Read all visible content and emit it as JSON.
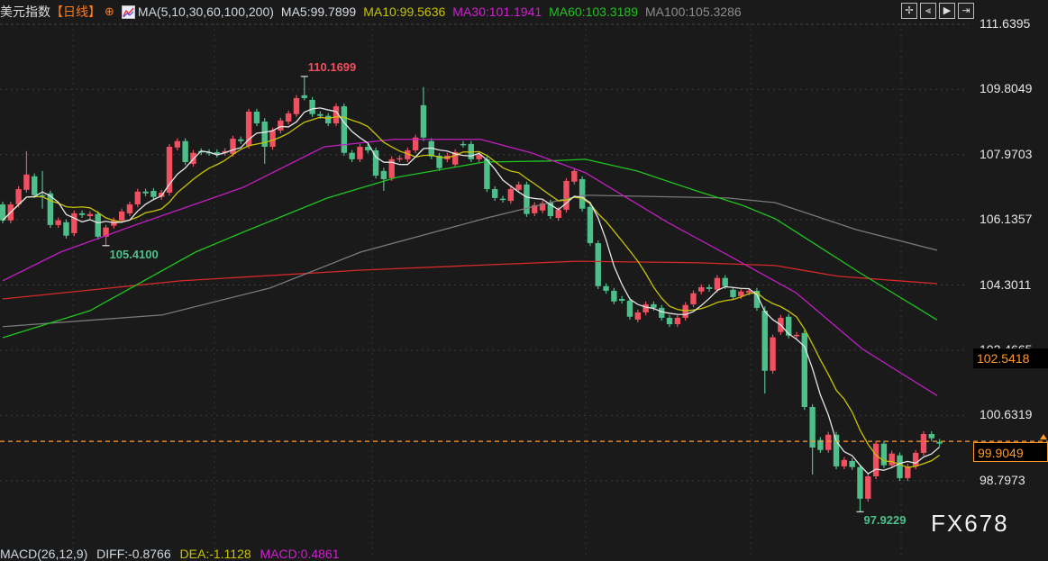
{
  "header": {
    "title": "美元指数",
    "period": "【日线】",
    "ma_params": "MA(5,10,30,60,100,200)",
    "ma5": "MA5:99.7899",
    "ma10": "MA10:99.5636",
    "ma30": "MA30:101.1941",
    "ma60": "MA60:103.3189",
    "ma100": "MA100:105.3286"
  },
  "toolbar": [
    {
      "icon": "crosshair-icon",
      "glyph": "✢"
    },
    {
      "icon": "zoom-left-icon",
      "glyph": "⫷"
    },
    {
      "icon": "play-forward-icon",
      "glyph": "▶"
    },
    {
      "icon": "jump-end-icon",
      "glyph": "⇥"
    }
  ],
  "macd": {
    "label": "MACD(26,12,9)",
    "diff": "DIFF:-0.8766",
    "dea": "DEA:-1.1128",
    "macd": "MACD:0.4861"
  },
  "watermark": "FX678",
  "chart_data": {
    "type": "candlestick",
    "ylim": [
      96.69,
      112.32
    ],
    "y_ticks": [
      "111.6395",
      "109.8049",
      "107.9703",
      "106.1357",
      "104.3011",
      "102.4665",
      "100.6319",
      "98.7973"
    ],
    "grid": true,
    "colors": {
      "up": "#f0505f",
      "down": "#4ebf8b",
      "ma5": "#e6e6e6",
      "ma10": "#c7c400",
      "ma30": "#c21fc2",
      "ma60": "#1fc41f",
      "ma100": "#7a7a7a",
      "ma200": "#d42a2a",
      "current": "#ff9a2a"
    },
    "candles_oc_hl": [
      [
        106.57,
        106.12
      ],
      [
        106.12,
        106.57
      ],
      [
        106.57,
        107.0
      ],
      [
        106.98,
        107.41,
        108.07
      ],
      [
        107.36,
        106.83
      ],
      [
        106.83,
        106.8,
        107.51,
        106.45
      ],
      [
        106.88,
        105.99
      ],
      [
        105.99,
        106.12
      ],
      [
        106.07,
        105.69
      ],
      [
        105.76,
        106.32
      ],
      [
        106.32,
        106.27
      ],
      [
        106.24,
        106.3
      ],
      [
        106.3,
        105.66
      ],
      [
        105.66,
        105.92,
        106.0,
        105.41
      ],
      [
        105.97,
        106.12
      ],
      [
        106.12,
        106.37
      ],
      [
        106.32,
        106.57
      ],
      [
        106.57,
        106.93
      ],
      [
        106.93,
        106.88
      ],
      [
        106.95,
        106.78
      ],
      [
        106.78,
        106.9
      ],
      [
        106.9,
        108.19
      ],
      [
        108.17,
        108.35
      ],
      [
        108.35,
        107.76
      ],
      [
        107.71,
        108.02
      ],
      [
        108.07,
        108.04
      ],
      [
        108.04,
        108.02
      ],
      [
        108.04,
        107.97
      ],
      [
        108.02,
        108.07
      ],
      [
        107.99,
        108.42
      ],
      [
        108.4,
        108.35
      ],
      [
        108.22,
        109.18
      ],
      [
        109.18,
        108.85
      ],
      [
        108.9,
        108.19,
        109.0,
        107.71
      ],
      [
        108.19,
        108.65
      ],
      [
        108.65,
        108.93
      ],
      [
        108.9,
        109.13
      ],
      [
        109.11,
        109.56
      ],
      [
        109.64,
        109.56,
        110.17,
        109.5
      ],
      [
        109.51,
        109.11
      ],
      [
        109.11,
        109.06
      ],
      [
        109.06,
        108.85
      ],
      [
        108.85,
        109.33
      ],
      [
        109.33,
        108.02
      ],
      [
        108.02,
        107.84
      ],
      [
        107.84,
        108.19
      ],
      [
        108.19,
        108.09
      ],
      [
        108.09,
        107.38
      ],
      [
        107.51,
        107.28,
        107.6,
        106.95
      ],
      [
        107.31,
        107.84
      ],
      [
        107.84,
        107.87
      ],
      [
        107.84,
        108.09
      ],
      [
        108.09,
        108.45
      ],
      [
        109.36,
        108.45,
        109.87,
        108.35
      ],
      [
        108.35,
        107.92
      ],
      [
        107.94,
        107.59
      ],
      [
        107.84,
        107.94
      ],
      [
        107.69,
        108.04
      ],
      [
        108.27,
        108.25
      ],
      [
        108.27,
        107.84
      ],
      [
        107.84,
        107.97
      ],
      [
        107.84,
        107.0
      ],
      [
        107.0,
        106.75
      ],
      [
        106.73,
        106.7
      ],
      [
        106.67,
        107.0
      ],
      [
        106.98,
        107.13
      ],
      [
        107.13,
        106.3
      ],
      [
        106.32,
        106.55
      ],
      [
        106.4,
        106.6
      ],
      [
        106.62,
        106.24
      ],
      [
        106.19,
        106.42
      ],
      [
        106.42,
        107.23
      ],
      [
        107.21,
        107.51
      ],
      [
        107.28,
        106.45
      ],
      [
        106.5,
        105.48
      ],
      [
        105.48,
        104.27
      ],
      [
        104.27,
        104.14
      ],
      [
        104.14,
        103.84
      ],
      [
        103.91,
        103.86
      ],
      [
        103.86,
        103.41
      ],
      [
        103.33,
        103.53
      ],
      [
        103.53,
        103.76
      ],
      [
        103.76,
        103.66
      ],
      [
        103.66,
        103.38
      ],
      [
        103.38,
        103.2
      ],
      [
        103.2,
        103.38
      ],
      [
        103.38,
        103.74
      ],
      [
        103.76,
        104.07
      ],
      [
        104.12,
        104.24
      ],
      [
        104.24,
        104.19
      ],
      [
        104.17,
        104.5
      ],
      [
        104.5,
        104.27
      ],
      [
        104.17,
        103.96
      ],
      [
        103.99,
        104.12
      ],
      [
        104.09,
        104.14
      ],
      [
        104.14,
        103.66
      ],
      [
        103.58,
        101.89,
        103.7,
        101.25
      ],
      [
        101.89,
        102.83
      ],
      [
        102.98,
        103.38
      ],
      [
        103.41,
        102.88
      ],
      [
        102.88,
        102.9
      ],
      [
        102.95,
        100.87
      ],
      [
        100.87,
        99.73,
        100.95,
        98.97
      ],
      [
        99.94,
        99.66
      ],
      [
        99.66,
        100.09
      ],
      [
        100.09,
        99.2
      ],
      [
        99.2,
        99.38
      ],
      [
        99.35,
        99.18
      ],
      [
        99.18,
        98.29,
        99.25,
        97.9229
      ],
      [
        98.29,
        98.92
      ],
      [
        98.92,
        99.84
      ],
      [
        99.84,
        99.23
      ],
      [
        99.23,
        99.56
      ],
      [
        99.51,
        98.87
      ],
      [
        98.87,
        99.2
      ],
      [
        99.2,
        99.58
      ],
      [
        99.58,
        100.11
      ],
      [
        100.11,
        99.99
      ],
      [
        99.89,
        99.84
      ]
    ],
    "moving_averages": {
      "ma30": [
        [
          0,
          104.42
        ],
        [
          7.3,
          105.23
        ],
        [
          16.7,
          105.99
        ],
        [
          30.3,
          107.05
        ],
        [
          40.5,
          108.19
        ],
        [
          49.3,
          108.4
        ],
        [
          60.2,
          108.4
        ],
        [
          66.6,
          108.02
        ],
        [
          73.4,
          107.46
        ],
        [
          83.7,
          106.07
        ],
        [
          91.3,
          105.15
        ],
        [
          99.9,
          104.09
        ],
        [
          108.3,
          102.5
        ],
        [
          117.7,
          101.19
        ]
      ],
      "ma60": [
        [
          0,
          102.82
        ],
        [
          11,
          103.58
        ],
        [
          24.3,
          105.23
        ],
        [
          30.3,
          105.79
        ],
        [
          40.9,
          106.75
        ],
        [
          49.6,
          107.33
        ],
        [
          60.6,
          107.76
        ],
        [
          68.6,
          107.79
        ],
        [
          73.4,
          107.84
        ],
        [
          79.9,
          107.51
        ],
        [
          87.4,
          106.95
        ],
        [
          93.1,
          106.55
        ],
        [
          97.3,
          106.17
        ],
        [
          108.3,
          104.6
        ],
        [
          117.7,
          103.32
        ]
      ],
      "ma100": [
        [
          0,
          103.13
        ],
        [
          20.1,
          103.46
        ],
        [
          33.7,
          104.22
        ],
        [
          45.1,
          105.23
        ],
        [
          61,
          106.19
        ],
        [
          70.4,
          106.7
        ],
        [
          73.4,
          106.83
        ],
        [
          91.3,
          106.75
        ],
        [
          97.3,
          106.62
        ],
        [
          107.5,
          105.86
        ],
        [
          117.7,
          105.28
        ]
      ],
      "ma200": [
        [
          0,
          103.91
        ],
        [
          22.4,
          104.42
        ],
        [
          45.1,
          104.72
        ],
        [
          61,
          104.87
        ],
        [
          72.3,
          104.97
        ],
        [
          87.4,
          104.93
        ],
        [
          97.3,
          104.85
        ],
        [
          105.2,
          104.55
        ],
        [
          117.7,
          104.34
        ]
      ]
    },
    "annotations": {
      "high": {
        "text": "110.1699",
        "index": 38,
        "color": "#f0505f"
      },
      "low_left": {
        "text": "105.4100",
        "index": 13,
        "color": "#4ebf8b"
      },
      "low": {
        "text": "97.9229",
        "index": 108,
        "color": "#4ebf8b"
      }
    },
    "current_price": "99.9049",
    "crosshair_price": "102.5418"
  }
}
